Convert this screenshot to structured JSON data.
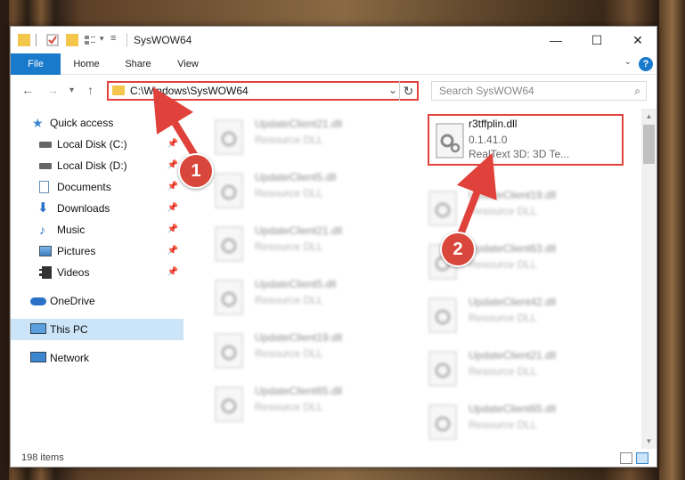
{
  "window": {
    "title": "SysWOW64"
  },
  "ribbon": {
    "tabs": [
      "File",
      "Home",
      "Share",
      "View"
    ],
    "help": "?"
  },
  "nav": {
    "back": "←",
    "forward": "→",
    "recent": "▾",
    "up": "↑",
    "address": "C:\\Windows\\SysWOW64",
    "search_placeholder": "Search SysWOW64"
  },
  "sidebar": {
    "items": [
      {
        "label": "Quick access"
      },
      {
        "label": "Local Disk (C:)"
      },
      {
        "label": "Local Disk (D:)"
      },
      {
        "label": "Documents"
      },
      {
        "label": "Downloads"
      },
      {
        "label": "Music"
      },
      {
        "label": "Pictures"
      },
      {
        "label": "Videos"
      },
      {
        "label": "OneDrive"
      },
      {
        "label": "This PC"
      },
      {
        "label": "Network"
      }
    ]
  },
  "files": {
    "highlighted": {
      "name": "r3tffplin.dll",
      "version": "0.1.41.0",
      "description": "RealText 3D:  3D Te..."
    },
    "left_column": [
      {
        "name": "UpdateClient21.dll",
        "type": "Resource DLL"
      },
      {
        "name": "UpdateClient5.dll",
        "type": "Resource DLL"
      },
      {
        "name": "UpdateClient21.dll",
        "type": "Resource DLL"
      },
      {
        "name": "UpdateClient5.dll",
        "type": "Resource DLL"
      },
      {
        "name": "UpdateClient19.dll",
        "type": "Resource DLL"
      },
      {
        "name": "UpdateClient65.dll",
        "type": "Resource DLL"
      }
    ],
    "right_column": [
      {
        "name": "UpdateClient19.dll",
        "type": "Resource DLL"
      },
      {
        "name": "UpdateClient63.dll",
        "type": "Resource DLL"
      },
      {
        "name": "UpdateClient42.dll",
        "type": "Resource DLL"
      },
      {
        "name": "UpdateClient21.dll",
        "type": "Resource DLL"
      },
      {
        "name": "UpdateClient65.dll",
        "type": "Resource DLL"
      }
    ]
  },
  "status": {
    "count": "198 items"
  },
  "annotations": {
    "step1": "1",
    "step2": "2",
    "color": "#e0413a"
  },
  "icons": [
    "folder-icon",
    "pin-icon",
    "gear-file-icon",
    "star-icon",
    "drive-icon",
    "cloud-icon",
    "monitor-icon",
    "network-icon"
  ]
}
